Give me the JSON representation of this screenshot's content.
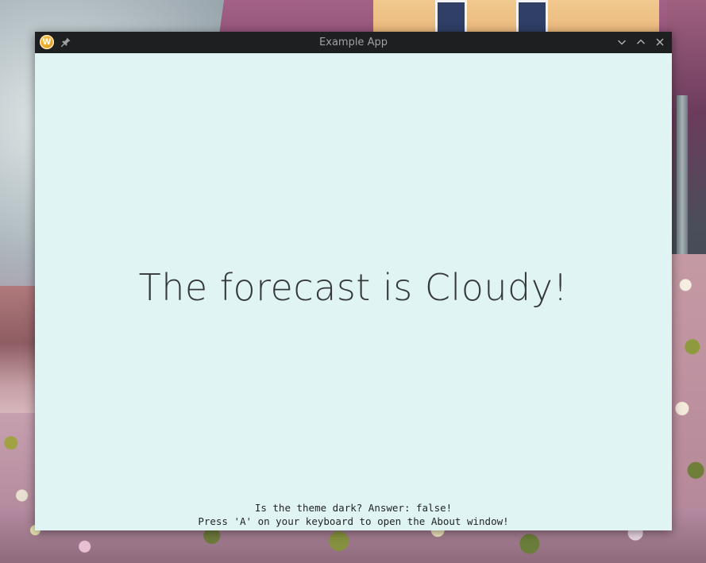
{
  "window": {
    "title": "Example App",
    "app_icon_letter": "W",
    "icons": {
      "app": "app-logo-icon",
      "pin": "pin-icon",
      "minimize": "chevron-down-icon",
      "maximize": "chevron-up-icon",
      "close": "close-icon"
    }
  },
  "content": {
    "headline": "The forecast is Cloudy!",
    "theme_line": "Is the theme dark? Answer: false!",
    "hint_line": "Press 'A' on your keyboard to open the About window!"
  },
  "colors": {
    "titlebar": "#1e1f21",
    "content_background": "#e0f4f4",
    "headline_text": "#34383b",
    "app_icon": "#e39b1d"
  }
}
